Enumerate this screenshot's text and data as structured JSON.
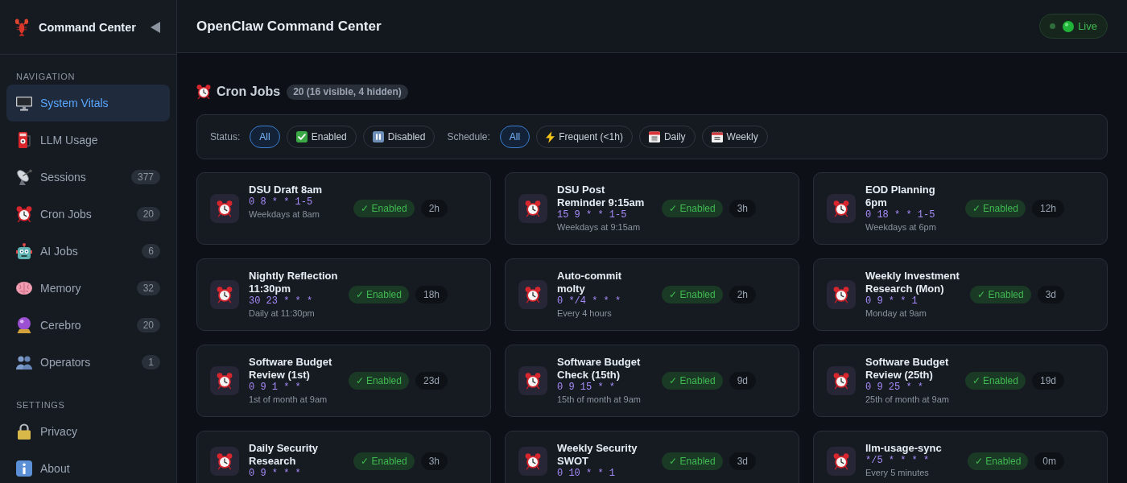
{
  "sidebar": {
    "title": "Command Center",
    "sections": [
      {
        "heading": "NAVIGATION",
        "items": [
          {
            "label": "System Vitals",
            "selected": true
          },
          {
            "label": "LLM Usage",
            "selected": false
          },
          {
            "label": "Sessions",
            "count": "377",
            "selected": false
          },
          {
            "label": "Cron Jobs",
            "count": "20",
            "selected": false
          },
          {
            "label": "AI Jobs",
            "count": "6",
            "selected": false
          },
          {
            "label": "Memory",
            "count": "32",
            "selected": false
          },
          {
            "label": "Cerebro",
            "count": "20",
            "selected": false
          },
          {
            "label": "Operators",
            "count": "1",
            "selected": false
          }
        ]
      },
      {
        "heading": "SETTINGS",
        "items": [
          {
            "label": "Privacy",
            "selected": false
          },
          {
            "label": "About",
            "selected": false
          }
        ]
      }
    ]
  },
  "header": {
    "title": "OpenClaw Command Center",
    "status": {
      "label": "Live",
      "live": true
    }
  },
  "section": {
    "title": "Cron Jobs",
    "summary": "20 (16 visible, 4 hidden)"
  },
  "filters": [
    {
      "label": "Status:",
      "options": [
        {
          "label": "All",
          "selected": true
        },
        {
          "label": "Enabled",
          "selected": false
        },
        {
          "label": "Disabled",
          "selected": false
        }
      ]
    },
    {
      "label": "Schedule:",
      "options": [
        {
          "label": "All",
          "selected": true
        },
        {
          "label": "Frequent (<1h)",
          "selected": false
        },
        {
          "label": "Daily",
          "selected": false
        },
        {
          "label": "Weekly",
          "selected": false
        }
      ]
    }
  ],
  "jobs": [
    {
      "name": "DSU Draft 8am",
      "cron": "0 8 * * 1-5",
      "description": "Weekdays at 8am",
      "status": "✓ Enabled",
      "enabled": true,
      "duration": "2h"
    },
    {
      "name": "DSU Post Reminder 9:15am",
      "cron": "15 9 * * 1-5",
      "description": "Weekdays at 9:15am",
      "status": "✓ Enabled",
      "enabled": true,
      "duration": "3h"
    },
    {
      "name": "EOD Planning 6pm",
      "cron": "0 18 * * 1-5",
      "description": "Weekdays at 6pm",
      "status": "✓ Enabled",
      "enabled": true,
      "duration": "12h"
    },
    {
      "name": "Nightly Reflection 11:30pm",
      "cron": "30 23 * * *",
      "description": "Daily at 11:30pm",
      "status": "✓ Enabled",
      "enabled": true,
      "duration": "18h"
    },
    {
      "name": "Auto-commit molty",
      "cron": "0 */4 * * *",
      "description": "Every 4 hours",
      "status": "✓ Enabled",
      "enabled": true,
      "duration": "2h"
    },
    {
      "name": "Weekly Investment Research (Mon)",
      "cron": "0 9 * * 1",
      "description": "Monday at 9am",
      "status": "✓ Enabled",
      "enabled": true,
      "duration": "3d"
    },
    {
      "name": "Software Budget Review (1st)",
      "cron": "0 9 1 * *",
      "description": "1st of month at 9am",
      "status": "✓ Enabled",
      "enabled": true,
      "duration": "23d"
    },
    {
      "name": "Software Budget Check (15th)",
      "cron": "0 9 15 * *",
      "description": "15th of month at 9am",
      "status": "✓ Enabled",
      "enabled": true,
      "duration": "9d"
    },
    {
      "name": "Software Budget Review (25th)",
      "cron": "0 9 25 * *",
      "description": "25th of month at 9am",
      "status": "✓ Enabled",
      "enabled": true,
      "duration": "19d"
    },
    {
      "name": "Daily Security Research",
      "cron": "0 9 * * *",
      "status": "✓ Enabled",
      "enabled": true,
      "duration": "3h"
    },
    {
      "name": "Weekly Security SWOT",
      "cron": "0 10 * * 1",
      "status": "✓ Enabled",
      "enabled": true,
      "duration": "3d"
    },
    {
      "name": "llm-usage-sync",
      "cron": "*/5 * * * *",
      "description": "Every 5 minutes",
      "status": "✓ Enabled",
      "enabled": true,
      "duration": "0m"
    }
  ]
}
